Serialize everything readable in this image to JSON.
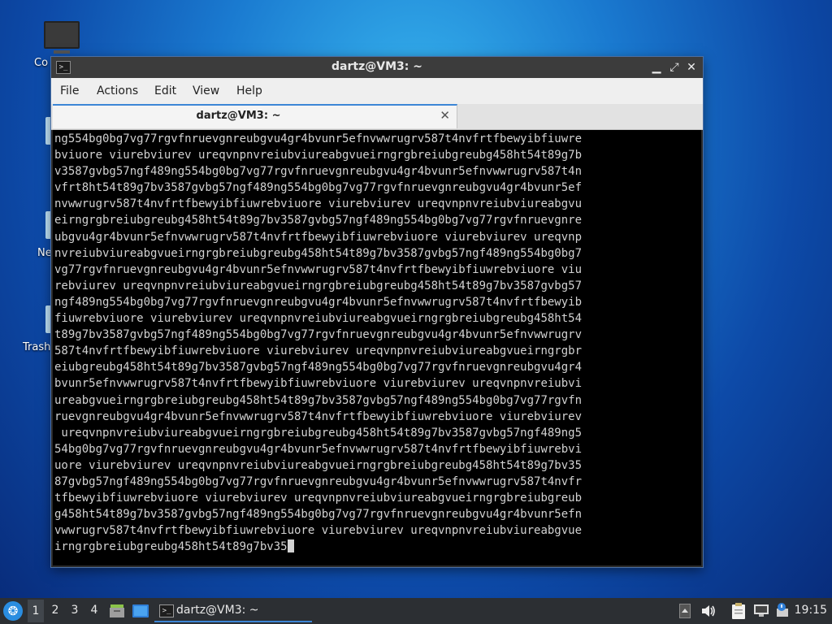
{
  "desktop": {
    "icons": [
      {
        "label": "Co"
      },
      {
        "label": "Ne"
      },
      {
        "label": "Trash"
      }
    ]
  },
  "window": {
    "title": "dartz@VM3: ~",
    "app_icon": ">_",
    "controls": {
      "minimize": "▁",
      "maximize": "⤢",
      "close": "✕"
    },
    "menu": [
      "File",
      "Actions",
      "Edit",
      "View",
      "Help"
    ],
    "tab": {
      "label": "dartz@VM3: ~",
      "close": "✕"
    },
    "terminal_lines": [
      "ng554bg0bg7vg77rgvfnruevgnreubgvu4gr4bvunr5efnvwwrugrv587t4nvfrtfbewyibfiuwre",
      "bviuore viurebviurev ureqvnpnvreiubviureabgvueirngrgbreiubgreubg458ht54t89g7b",
      "v3587gvbg57ngf489ng554bg0bg7vg77rgvfnruevgnreubgvu4gr4bvunr5efnvwwrugrv587t4n",
      "vfrt8ht54t89g7bv3587gvbg57ngf489ng554bg0bg7vg77rgvfnruevgnreubgvu4gr4bvunr5ef",
      "nvwwrugrv587t4nvfrtfbewyibfiuwrebviuore viurebviurev ureqvnpnvreiubviureabgvu",
      "eirngrgbreiubgreubg458ht54t89g7bv3587gvbg57ngf489ng554bg0bg7vg77rgvfnruevgnre",
      "ubgvu4gr4bvunr5efnvwwrugrv587t4nvfrtfbewyibfiuwrebviuore viurebviurev ureqvnp",
      "nvreiubviureabgvueirngrgbreiubgreubg458ht54t89g7bv3587gvbg57ngf489ng554bg0bg7",
      "vg77rgvfnruevgnreubgvu4gr4bvunr5efnvwwrugrv587t4nvfrtfbewyibfiuwrebviuore viu",
      "rebviurev ureqvnpnvreiubviureabgvueirngrgbreiubgreubg458ht54t89g7bv3587gvbg57",
      "ngf489ng554bg0bg7vg77rgvfnruevgnreubgvu4gr4bvunr5efnvwwrugrv587t4nvfrtfbewyib",
      "fiuwrebviuore viurebviurev ureqvnpnvreiubviureabgvueirngrgbreiubgreubg458ht54",
      "t89g7bv3587gvbg57ngf489ng554bg0bg7vg77rgvfnruevgnreubgvu4gr4bvunr5efnvwwrugrv",
      "587t4nvfrtfbewyibfiuwrebviuore viurebviurev ureqvnpnvreiubviureabgvueirngrgbr",
      "eiubgreubg458ht54t89g7bv3587gvbg57ngf489ng554bg0bg7vg77rgvfnruevgnreubgvu4gr4",
      "bvunr5efnvwwrugrv587t4nvfrtfbewyibfiuwrebviuore viurebviurev ureqvnpnvreiubvi",
      "ureabgvueirngrgbreiubgreubg458ht54t89g7bv3587gvbg57ngf489ng554bg0bg7vg77rgvfn",
      "ruevgnreubgvu4gr4bvunr5efnvwwrugrv587t4nvfrtfbewyibfiuwrebviuore viurebviurev",
      " ureqvnpnvreiubviureabgvueirngrgbreiubgreubg458ht54t89g7bv3587gvbg57ngf489ng5",
      "54bg0bg7vg77rgvfnruevgnreubgvu4gr4bvunr5efnvwwrugrv587t4nvfrtfbewyibfiuwrebvi",
      "uore viurebviurev ureqvnpnvreiubviureabgvueirngrgbreiubgreubg458ht54t89g7bv35",
      "87gvbg57ngf489ng554bg0bg7vg77rgvfnruevgnreubgvu4gr4bvunr5efnvwwrugrv587t4nvfr",
      "tfbewyibfiuwrebviuore viurebviurev ureqvnpnvreiubviureabgvueirngrgbreiubgreub",
      "g458ht54t89g7bv3587gvbg57ngf489ng554bg0bg7vg77rgvfnruevgnreubgvu4gr4bvunr5efn",
      "vwwrugrv587t4nvfrtfbewyibfiuwrebviuore viurebviurev ureqvnpnvreiubviureabgvue",
      "irngrgbreiubgreubg458ht54t89g7bv35"
    ]
  },
  "taskbar": {
    "start_glyph": "❂",
    "workspaces": [
      "1",
      "2",
      "3",
      "4"
    ],
    "active_workspace": "1",
    "task": {
      "icon": ">_",
      "label": "dartz@VM3: ~"
    },
    "clock": "19:15"
  }
}
